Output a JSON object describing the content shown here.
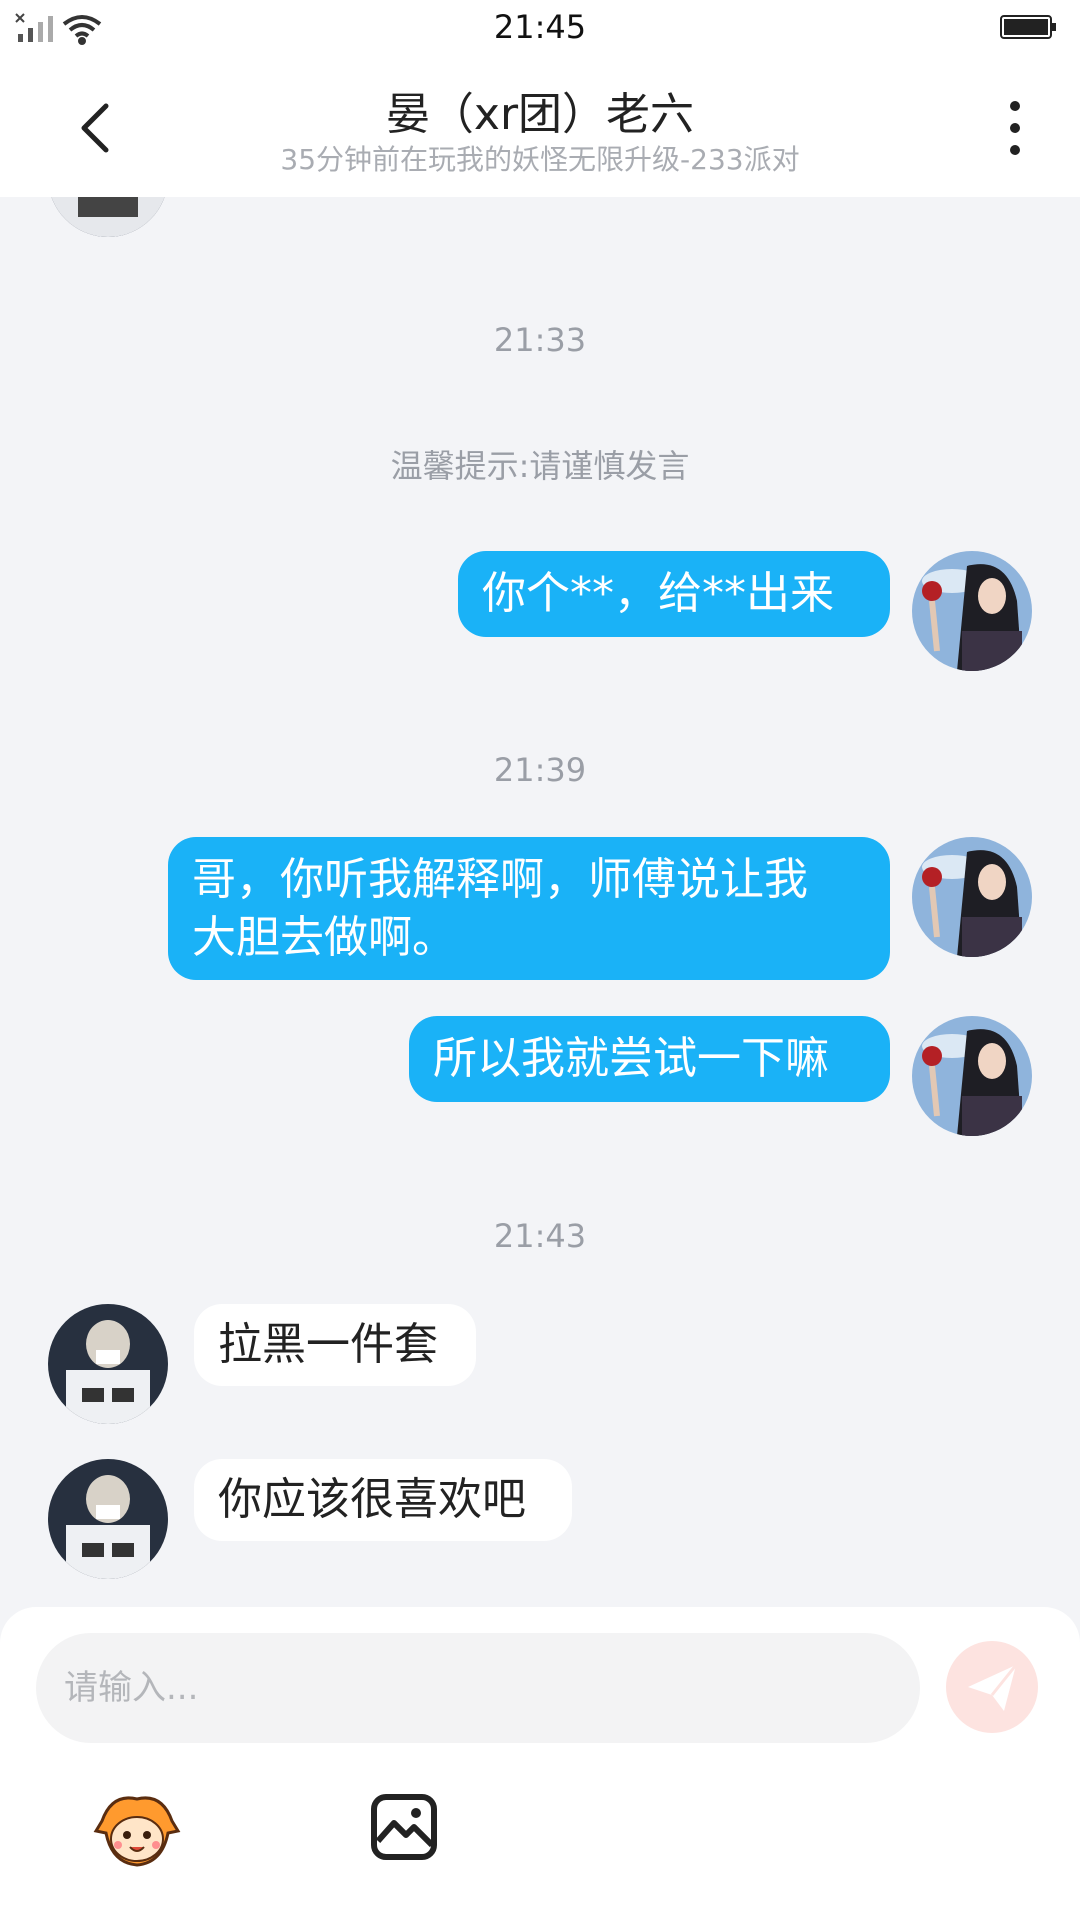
{
  "status_bar": {
    "time": "21:45",
    "icons": [
      "no-sim-icon",
      "signal-icon",
      "wifi-icon",
      "battery-icon"
    ]
  },
  "header": {
    "title": "晏（xr团）老六",
    "subtitle": "35分钟前在玩我的妖怪无限升级-233派对",
    "back_icon": "back-arrow-icon",
    "menu_icon": "more-vertical-icon"
  },
  "chat": {
    "timestamps": [
      "21:33",
      "21:39",
      "21:43"
    ],
    "tip": "温馨提示:请谨慎发言",
    "messages": [
      {
        "side": "out",
        "text": "你个**，给**出来",
        "time_group": "21:33"
      },
      {
        "side": "out",
        "text_line1": "哥，你听我解释啊，师傅说让我",
        "text_line2": "大胆去做啊。",
        "time_group": "21:39"
      },
      {
        "side": "out",
        "text": "所以我就尝试一下嘛",
        "time_group": "21:39"
      },
      {
        "side": "in",
        "text": "拉黑一件套",
        "time_group": "21:43"
      },
      {
        "side": "in",
        "text": "你应该很喜欢吧",
        "time_group": "21:43"
      }
    ]
  },
  "composer": {
    "placeholder": "请输入...",
    "send_icon": "send-icon",
    "emoji_icon": "emoji-icon",
    "image_icon": "image-icon"
  },
  "colors": {
    "outgoing_bubble": "#1ab2f7",
    "incoming_bubble": "#ffffff",
    "background": "#f3f4f7",
    "send_button": "#fde3e0"
  }
}
